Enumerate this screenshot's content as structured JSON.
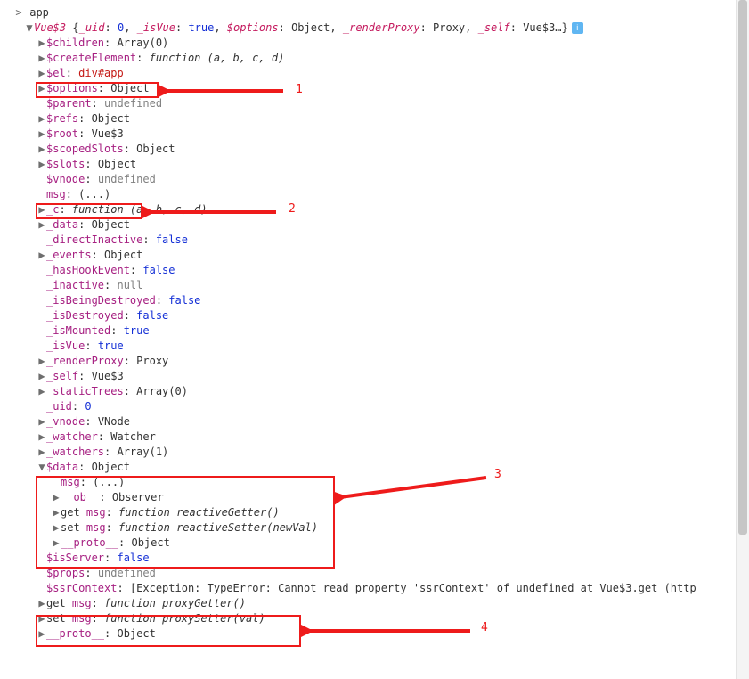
{
  "root": {
    "arrow": ">",
    "label": "app"
  },
  "vueHeader": {
    "arrow": "▼",
    "class": "Vue$3",
    "preview": [
      {
        "k": "_uid",
        "v": "0",
        "t": "num"
      },
      {
        "k": "_isVue",
        "v": "true",
        "t": "bool"
      },
      {
        "k": "$options",
        "v": "Object",
        "t": "plain"
      },
      {
        "k": "_renderProxy",
        "v": "Proxy",
        "t": "plain"
      },
      {
        "k": "_self",
        "v": "Vue$3…",
        "t": "plain"
      }
    ]
  },
  "props": [
    {
      "a": "▶",
      "key": "$children",
      "val": "Array(0)",
      "t": "plain"
    },
    {
      "a": "▶",
      "key": "$createElement",
      "val": "function (a, b, c, d)",
      "t": "func"
    },
    {
      "a": "▶",
      "key": "$el",
      "val": "div#app",
      "t": "str",
      "box": 1
    },
    {
      "a": "▶",
      "key": "$options",
      "val": "Object",
      "t": "plain"
    },
    {
      "a": "",
      "key": "$parent",
      "val": "undefined",
      "t": "undef"
    },
    {
      "a": "▶",
      "key": "$refs",
      "val": "Object",
      "t": "plain"
    },
    {
      "a": "▶",
      "key": "$root",
      "val": "Vue$3",
      "t": "plain"
    },
    {
      "a": "▶",
      "key": "$scopedSlots",
      "val": "Object",
      "t": "plain"
    },
    {
      "a": "▶",
      "key": "$slots",
      "val": "Object",
      "t": "plain"
    },
    {
      "a": "",
      "key": "$vnode",
      "val": "undefined",
      "t": "undef"
    },
    {
      "a": "",
      "key": "msg",
      "val": "(...)",
      "t": "plain",
      "box": 2
    },
    {
      "a": "▶",
      "key": "_c",
      "val": "function (a, b, c, d)",
      "t": "func"
    },
    {
      "a": "▶",
      "key": "_data",
      "val": "Object",
      "t": "plain"
    },
    {
      "a": "",
      "key": "_directInactive",
      "val": "false",
      "t": "bool"
    },
    {
      "a": "▶",
      "key": "_events",
      "val": "Object",
      "t": "plain"
    },
    {
      "a": "",
      "key": "_hasHookEvent",
      "val": "false",
      "t": "bool"
    },
    {
      "a": "",
      "key": "_inactive",
      "val": "null",
      "t": "undef"
    },
    {
      "a": "",
      "key": "_isBeingDestroyed",
      "val": "false",
      "t": "bool"
    },
    {
      "a": "",
      "key": "_isDestroyed",
      "val": "false",
      "t": "bool"
    },
    {
      "a": "",
      "key": "_isMounted",
      "val": "true",
      "t": "bool"
    },
    {
      "a": "",
      "key": "_isVue",
      "val": "true",
      "t": "bool"
    },
    {
      "a": "▶",
      "key": "_renderProxy",
      "val": "Proxy",
      "t": "plain"
    },
    {
      "a": "▶",
      "key": "_self",
      "val": "Vue$3",
      "t": "plain"
    },
    {
      "a": "▶",
      "key": "_staticTrees",
      "val": "Array(0)",
      "t": "plain"
    },
    {
      "a": "",
      "key": "_uid",
      "val": "0",
      "t": "num"
    },
    {
      "a": "▶",
      "key": "_vnode",
      "val": "VNode",
      "t": "plain"
    },
    {
      "a": "▶",
      "key": "_watcher",
      "val": "Watcher",
      "t": "plain"
    },
    {
      "a": "▶",
      "key": "_watchers",
      "val": "Array(1)",
      "t": "plain"
    }
  ],
  "dataHeader": {
    "a": "▼",
    "key": "$data",
    "val": "Object",
    "t": "plain",
    "box": 3
  },
  "dataChildren": [
    {
      "a": "",
      "key": "msg",
      "val": "(...)",
      "t": "plain"
    },
    {
      "a": "▶",
      "key": "__ob__",
      "val": "Observer",
      "t": "plain"
    },
    {
      "a": "▶",
      "prefix": "get ",
      "key": "msg",
      "val": "function reactiveGetter()",
      "t": "func"
    },
    {
      "a": "▶",
      "prefix": "set ",
      "key": "msg",
      "val": "function reactiveSetter(newVal)",
      "t": "func"
    },
    {
      "a": "▶",
      "key": "__proto__",
      "val": "Object",
      "t": "plain"
    }
  ],
  "afterData": [
    {
      "a": "",
      "key": "$isServer",
      "val": "false",
      "t": "bool"
    },
    {
      "a": "",
      "key": "$props",
      "val": "undefined",
      "t": "undef"
    },
    {
      "a": "",
      "key": "$ssrContext",
      "val": "[Exception: TypeError: Cannot read property 'ssrContext' of undefined at Vue$3.get (http",
      "t": "plain"
    }
  ],
  "box4": [
    {
      "a": "▶",
      "prefix": "get ",
      "key": "msg",
      "val": "function proxyGetter()",
      "t": "func"
    },
    {
      "a": "▶",
      "prefix": "set ",
      "key": "msg",
      "val": "function proxySetter(val)",
      "t": "func"
    }
  ],
  "proto": {
    "a": "▶",
    "key": "__proto__",
    "val": "Object",
    "t": "plain"
  },
  "labels": {
    "l1": "1",
    "l2": "2",
    "l3": "3",
    "l4": "4"
  }
}
